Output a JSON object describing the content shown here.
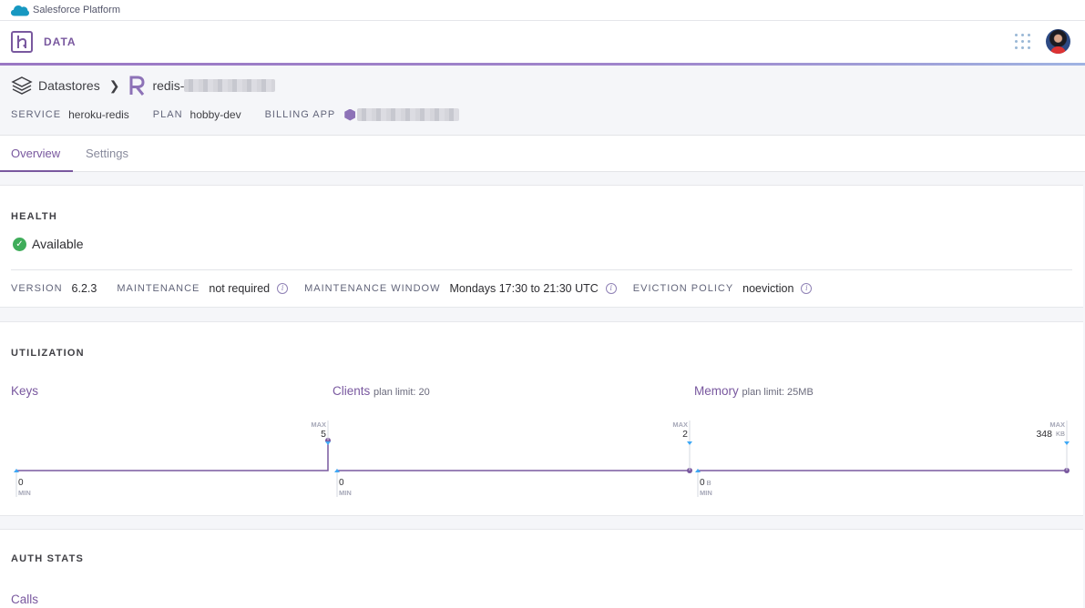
{
  "platform": {
    "label": "Salesforce Platform"
  },
  "app": {
    "name": "DATA"
  },
  "breadcrumb": {
    "root": "Datastores",
    "resource_prefix": "redis-"
  },
  "meta": {
    "service_label": "SERVICE",
    "service_value": "heroku-redis",
    "plan_label": "PLAN",
    "plan_value": "hobby-dev",
    "billing_label": "BILLING APP"
  },
  "tabs": [
    {
      "label": "Overview",
      "active": true
    },
    {
      "label": "Settings",
      "active": false
    }
  ],
  "health": {
    "title": "HEALTH",
    "status": "Available",
    "facts": {
      "version_label": "VERSION",
      "version_value": "6.2.3",
      "maintenance_label": "MAINTENANCE",
      "maintenance_value": "not required",
      "window_label": "MAINTENANCE WINDOW",
      "window_value": "Mondays 17:30 to 21:30 UTC",
      "eviction_label": "EVICTION POLICY",
      "eviction_value": "noeviction"
    }
  },
  "utilization": {
    "title": "UTILIZATION",
    "keys": {
      "title": "Keys",
      "limit": ""
    },
    "clients": {
      "title": "Clients",
      "limit": "plan limit: 20"
    },
    "memory": {
      "title": "Memory",
      "limit": "plan limit: 25MB"
    }
  },
  "chart_data": [
    {
      "type": "line",
      "title": "Keys",
      "min_label": "MIN",
      "max_label": "MAX",
      "min_value": "0",
      "max_value": "5",
      "min_unit": "",
      "max_unit": "",
      "ylim": [
        0,
        5
      ],
      "values": [
        0,
        0,
        0,
        0,
        5
      ]
    },
    {
      "type": "line",
      "title": "Clients",
      "min_label": "MIN",
      "max_label": "MAX",
      "min_value": "0",
      "max_value": "2",
      "min_unit": "",
      "max_unit": "",
      "ylim": [
        0,
        2
      ],
      "values": [
        0,
        0,
        0,
        0,
        0
      ]
    },
    {
      "type": "line",
      "title": "Memory",
      "min_label": "MIN",
      "max_label": "MAX",
      "min_value": "0",
      "max_value": "348",
      "min_unit": "B",
      "max_unit": "KB",
      "ylim": [
        0,
        348
      ],
      "values": [
        0,
        0,
        0,
        0,
        0
      ]
    }
  ],
  "auth": {
    "title": "AUTH STATS",
    "calls_title": "Calls"
  },
  "colors": {
    "accent": "#79589f",
    "marker": "#3fa9f5",
    "ok": "#3fad5a"
  },
  "icons": {
    "platform": "salesforce-cloud-icon",
    "app": "heroku-logo-icon",
    "apps": "app-grid-icon",
    "datastores": "datastores-stack-icon",
    "redis": "redis-logo-icon",
    "billing": "app-hexagon-icon",
    "status": "check-circle-icon",
    "info": "info-icon"
  }
}
